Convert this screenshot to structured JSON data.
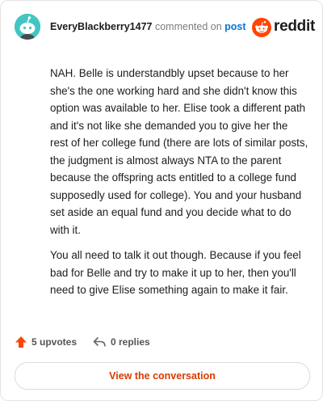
{
  "header": {
    "username": "EveryBlackberry1477",
    "action_text": "commented on",
    "post_link": "post",
    "brand": "reddit"
  },
  "comment": {
    "paragraphs": [
      "NAH. Belle is understandbly upset because to her she's the one working hard and she didn't know this option was available to her. Elise took a different path and it's not like she demanded you to give her the rest of her college fund (there are lots of similar posts, the judgment is almost always NTA to the parent because the offspring acts entitled to a college fund supposedly used for college). You and your husband set aside an equal fund and you decide what to do with it.",
      "You all need to talk it out though. Because if you feel bad for Belle and try to make it up to her, then you'll need to give Elise something again to make it fair."
    ]
  },
  "footer": {
    "upvotes": "5 upvotes",
    "replies": "0 replies",
    "view_label": "View the conversation"
  },
  "colors": {
    "accent": "#ff4500",
    "link": "#0079d3",
    "avatar_bg": "#43c6c3",
    "button_text": "#d93a00"
  },
  "icons": {
    "avatar": "snoo-avatar-icon",
    "brand": "reddit-logo-icon",
    "upvote": "upvote-arrow-icon",
    "reply": "reply-arrow-icon"
  }
}
